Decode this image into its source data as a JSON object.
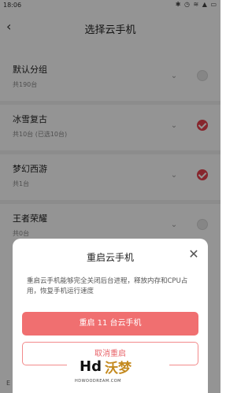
{
  "status_bar": {
    "time": "18:06",
    "icons": [
      "bluetooth-icon",
      "alarm-icon",
      "wifi-icon",
      "signal-icon",
      "battery-icon"
    ]
  },
  "header": {
    "title": "选择云手机"
  },
  "groups": [
    {
      "name": "默认分组",
      "count": "共190台",
      "selected": false
    },
    {
      "name": "冰雪复古",
      "count": "共10台 (已选10台)",
      "selected": true
    },
    {
      "name": "梦幻西游",
      "count": "共1台",
      "selected": true
    },
    {
      "name": "王者荣耀",
      "count": "共0台",
      "selected": false
    }
  ],
  "bottom_partial_text": "E",
  "dialog": {
    "title": "重启云手机",
    "body": "重启云手机能够完全关闭后台进程，释放内存和CPU占用，恢复手机运行速度",
    "primary_button": "重启 11 台云手机",
    "secondary_button": "取消重启"
  },
  "watermark": {
    "brand": "Hd",
    "brand_cn": "沃梦",
    "url": "HDWOODREAM.COM"
  },
  "colors": {
    "accent": "#e8434e",
    "primary_button": "#f06f70",
    "overlay": "rgba(0,0,0,0.42)"
  }
}
